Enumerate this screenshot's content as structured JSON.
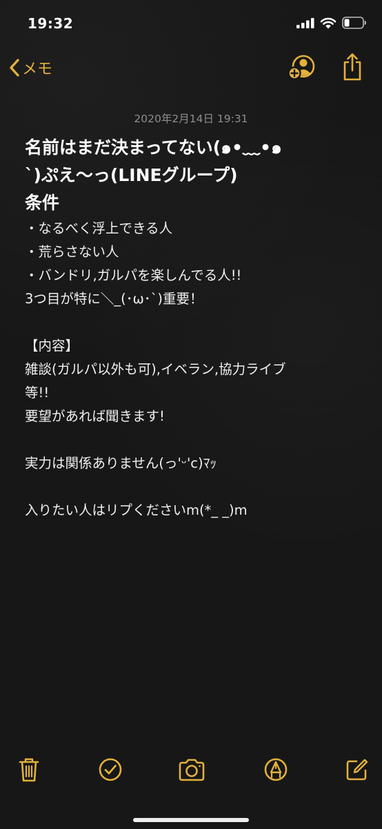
{
  "status_bar": {
    "time": "19:32"
  },
  "nav": {
    "back_label": "メモ"
  },
  "note": {
    "date": "2020年2月14日 19:31",
    "title_lines": [
      "名前はまだ決まってない(๑•﹏•๑",
      "`)ぷえ〜っ(LINEグループ)"
    ],
    "heading": "条件",
    "body_lines": [
      "・なるべく浮上できる人",
      "・荒らさない人",
      "・バンドリ,ガルパを楽しんでる人!!",
      "3つ目が特に＼_(･ω･`)重要！",
      "",
      "【内容】",
      "雑談(ガルパ以外も可),イベラン,協力ライブ",
      "等!!",
      "要望があれば聞きます!",
      "",
      "実力は関係ありません(っ'ᵕ'c)ﾏｯ",
      "",
      "入りたい人はリプくださいm(*_ _)m"
    ]
  },
  "colors": {
    "accent": "#e2b13c",
    "background": "#161616",
    "text": "#f2f2f2",
    "date_text": "#8e8e8e"
  },
  "icons": {
    "back": "chevron-left-icon",
    "share_user": "add-person-icon",
    "share": "share-icon",
    "trash": "trash-icon",
    "checklist": "checkmark-circle-icon",
    "camera": "camera-icon",
    "markup": "pen-tip-icon",
    "compose": "compose-icon"
  }
}
